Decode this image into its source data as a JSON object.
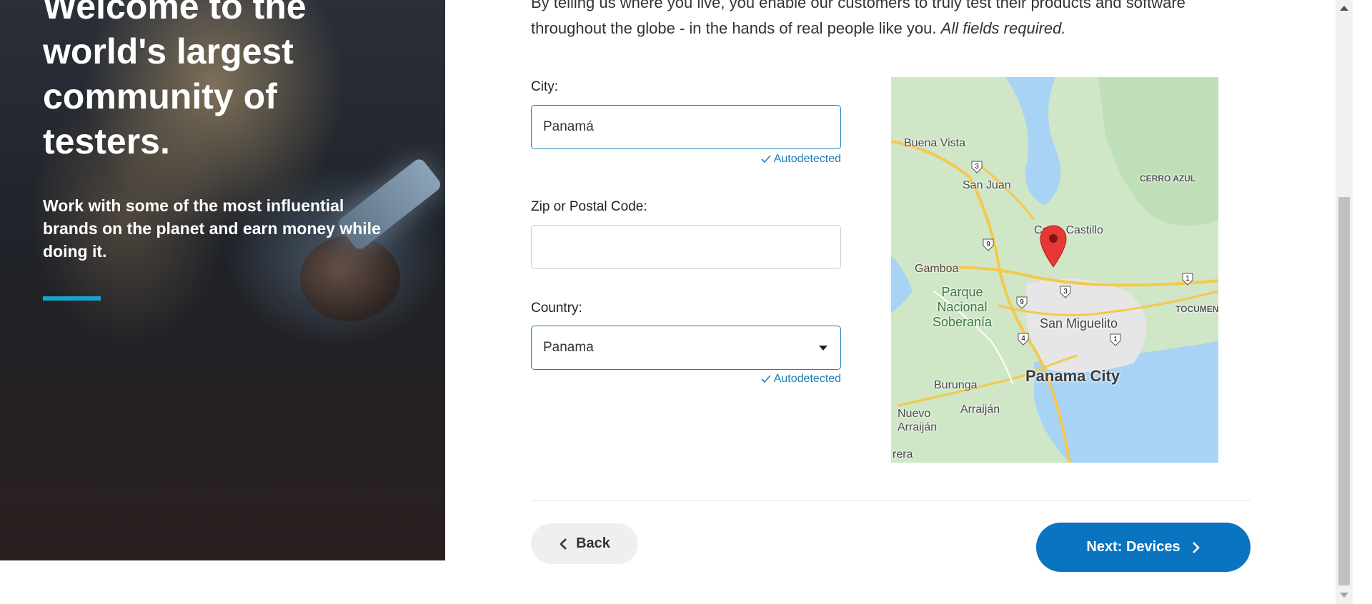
{
  "hero": {
    "title": "Welcome to the\nworld's largest\ncommunity of\ntesters.",
    "subtitle": "Work with some of the most influential brands on the planet and earn money while doing it."
  },
  "intro": {
    "text": "By telling us where you live, you enable our customers to truly test their products and software throughout the globe - in the hands of real people like you.",
    "note": "All fields required."
  },
  "form": {
    "city": {
      "label": "City:",
      "value": "Panamá",
      "status": "Autodetected"
    },
    "zip": {
      "label": "Zip or Postal Code:",
      "value": ""
    },
    "country": {
      "label": "Country:",
      "value": "Panama",
      "status": "Autodetected"
    }
  },
  "map": {
    "labels": {
      "buena_vista": "Buena Vista",
      "san_juan": "San Juan",
      "cerro_azul": "CERRO AZUL",
      "cerro_castillo": "Cerro Castillo",
      "gamboa": "Gamboa",
      "park": "Parque\nNacional\nSoberanía",
      "tocumen": "TOCUMEN",
      "san_miguelito": "San Miguelito",
      "panama_city": "Panama City",
      "burunga": "Burunga",
      "arraijan": "Arraiján",
      "nuevo_arraijan": "Nuevo\nArraiján",
      "rera": "rera"
    },
    "route_shields": [
      "3",
      "9",
      "9",
      "3",
      "1",
      "1",
      "4"
    ],
    "pin_icon": "map-pin-icon",
    "colors": {
      "land": "#cfe6c7",
      "water": "#a8d3f5",
      "road": "#f5c84c",
      "pin": "#e53935"
    }
  },
  "nav": {
    "back_label": "Back",
    "next_label": "Next: Devices"
  },
  "colors": {
    "accent": "#0a74c1",
    "link": "#1b7fb7",
    "hero_bar": "#1aa3c9"
  }
}
